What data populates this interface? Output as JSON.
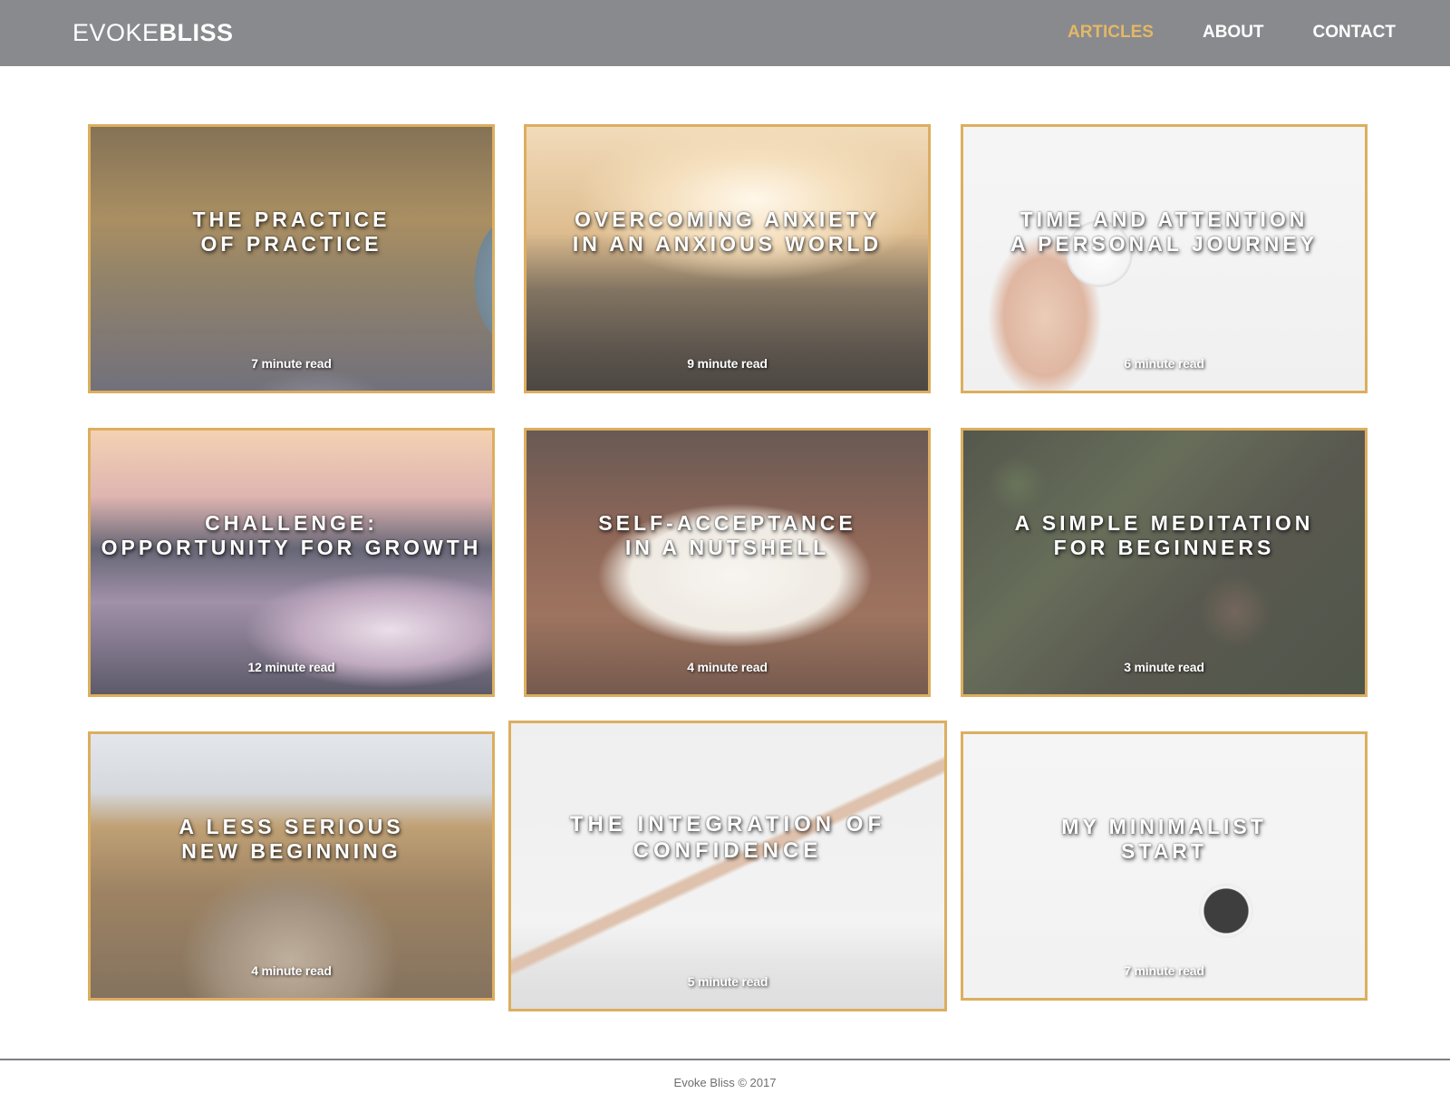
{
  "header": {
    "logo_light": "EVOKE",
    "logo_bold": "BLISS",
    "nav": [
      "ARTICLES",
      "ABOUT",
      "CONTACT"
    ]
  },
  "articles": [
    {
      "title": [
        "THE PRACTICE",
        "OF PRACTICE"
      ],
      "read": "7 minute read"
    },
    {
      "title": [
        "OVERCOMING ANXIETY",
        "IN AN ANXIOUS WORLD"
      ],
      "read": "9 minute read"
    },
    {
      "title": [
        "TIME AND ATTENTION",
        "A PERSONAL JOURNEY"
      ],
      "read": "6 minute read"
    },
    {
      "title": [
        "CHALLENGE:",
        "OPPORTUNITY FOR GROWTH"
      ],
      "read": "12 minute read"
    },
    {
      "title": [
        "SELF-ACCEPTANCE",
        "IN A NUTSHELL"
      ],
      "read": "4 minute read"
    },
    {
      "title": [
        "A SIMPLE MEDITATION",
        "FOR BEGINNERS"
      ],
      "read": "3 minute read"
    },
    {
      "title": [
        "A LESS SERIOUS",
        "NEW BEGINNING"
      ],
      "read": "4 minute read"
    },
    {
      "title": [
        "THE INTEGRATION OF",
        "CONFIDENCE"
      ],
      "read": "5 minute read"
    },
    {
      "title": [
        "MY MINIMALIST",
        "START"
      ],
      "read": "7 minute read"
    }
  ],
  "footer": {
    "text": "Evoke Bliss © 2017"
  },
  "colors": {
    "topbar": "#898a8e",
    "accent": "#e3b766",
    "card_border": "#dcae5f"
  }
}
